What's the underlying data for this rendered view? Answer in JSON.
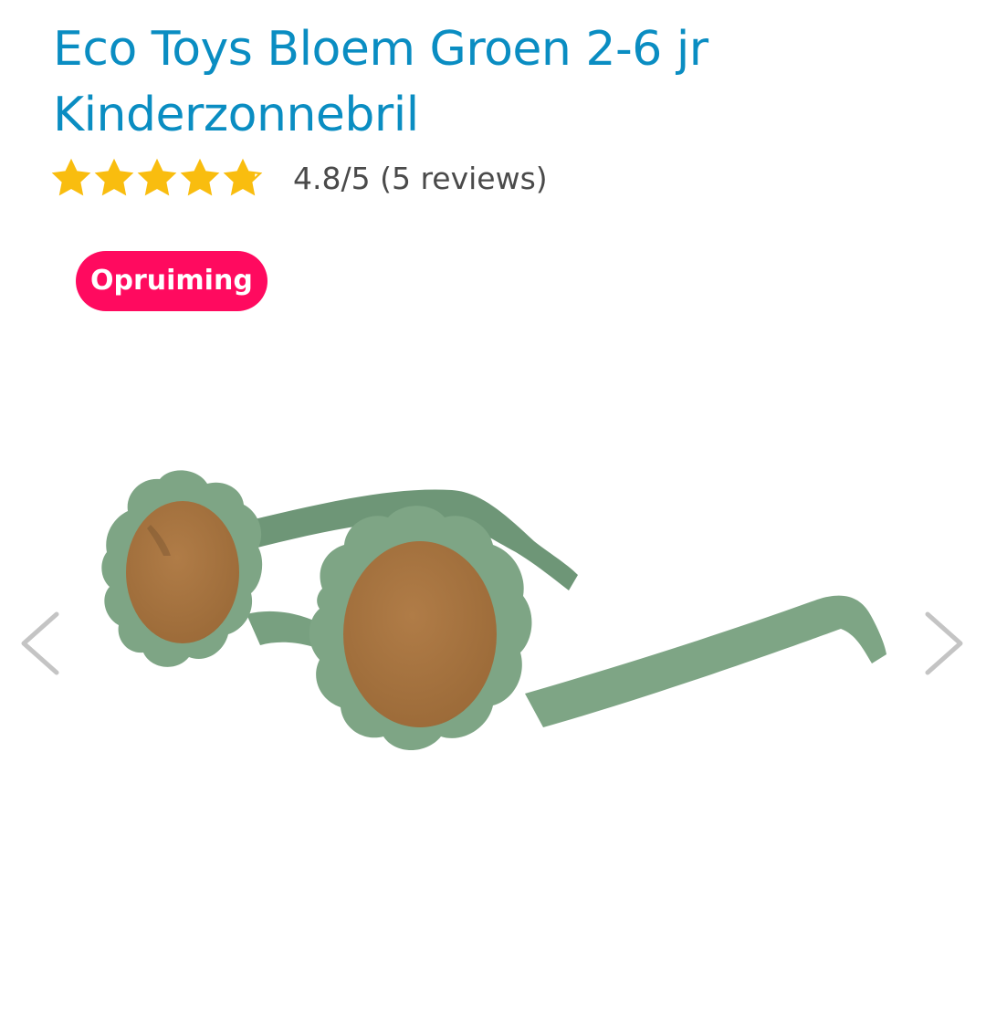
{
  "product": {
    "title": "Eco Toys Bloem Groen 2-6 jr Kinderzonnebril",
    "rating": 4.8,
    "rating_max": 5,
    "rating_text": "4.8/5 (5 reviews)",
    "badge": "Opruiming"
  },
  "gallery": {
    "prev_icon": "chevron-left-icon",
    "next_icon": "chevron-right-icon",
    "image_subject": "green flower-shaped kids sunglasses with brown lenses"
  },
  "colors": {
    "title": "#0a8dc2",
    "star": "#f9bd0f",
    "badge_bg": "#ff0a5f",
    "frame_green": "#7ea585",
    "lens_brown": "#a87440",
    "arrow_gray": "#c4c4c4"
  }
}
